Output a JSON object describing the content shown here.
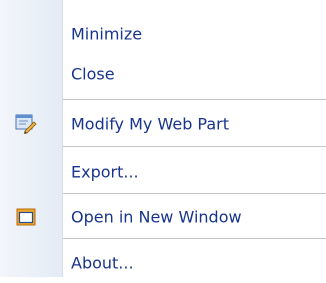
{
  "menu": {
    "items": [
      {
        "label": "Minimize",
        "icon": null
      },
      {
        "label": "Close",
        "icon": null
      },
      {
        "label": "Modify My Web Part",
        "icon": "edit-web-part-icon"
      },
      {
        "label": "Export...",
        "icon": null
      },
      {
        "label": "Open in New Window",
        "icon": "new-window-icon"
      },
      {
        "label": "About...",
        "icon": null
      }
    ]
  },
  "colors": {
    "label_text": "#18348c",
    "gutter_start": "#f3f6fa",
    "gutter_end": "#e3ebf5",
    "separator": "#c5c5c5",
    "background": "#ffffff"
  }
}
